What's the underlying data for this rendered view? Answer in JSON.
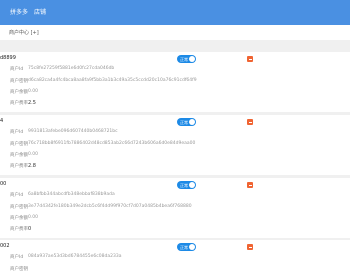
{
  "nav": {
    "items": [
      "拼多多",
      "店铺"
    ]
  },
  "breadcrumb": "商户中心 [+]",
  "field_labels": {
    "id": "商户Id",
    "secret": "商户密钥",
    "balance": "商户余额",
    "fee": "商户费率"
  },
  "toggle_label": "正常",
  "merchants": [
    {
      "name": "d8899",
      "id": "75c8fe27259f5881e6d0fc27cda046db",
      "secret": "d6ca82ca4a4fc4bca8aa8fa9f5bb3a1b3c49a35c5ccdd20c10a76c91cdf64f9",
      "balance": "0.00",
      "fee": "2.5"
    },
    {
      "name": "4",
      "id": "9931813afebe096d607440b0468721bc",
      "secret": "76c718bb8f6911fb7886402d48cd853ab2c66d7243b606a6d0e84d9eaa00",
      "balance": "0.00",
      "fee": "2.8"
    },
    {
      "name": "00",
      "id": "6a8bfbb344abcdfb348ebbaf838b9ada",
      "secret": "3e77d4342fe180b349e2dcb5c6f4dd99f970cf7d07a0485b4bea6f768880",
      "balance": "0.00",
      "fee": "0"
    },
    {
      "name": "002",
      "id": "084a937ae53d3bd6784455e6c08da233a",
      "secret": "",
      "balance": "",
      "fee": ""
    }
  ]
}
